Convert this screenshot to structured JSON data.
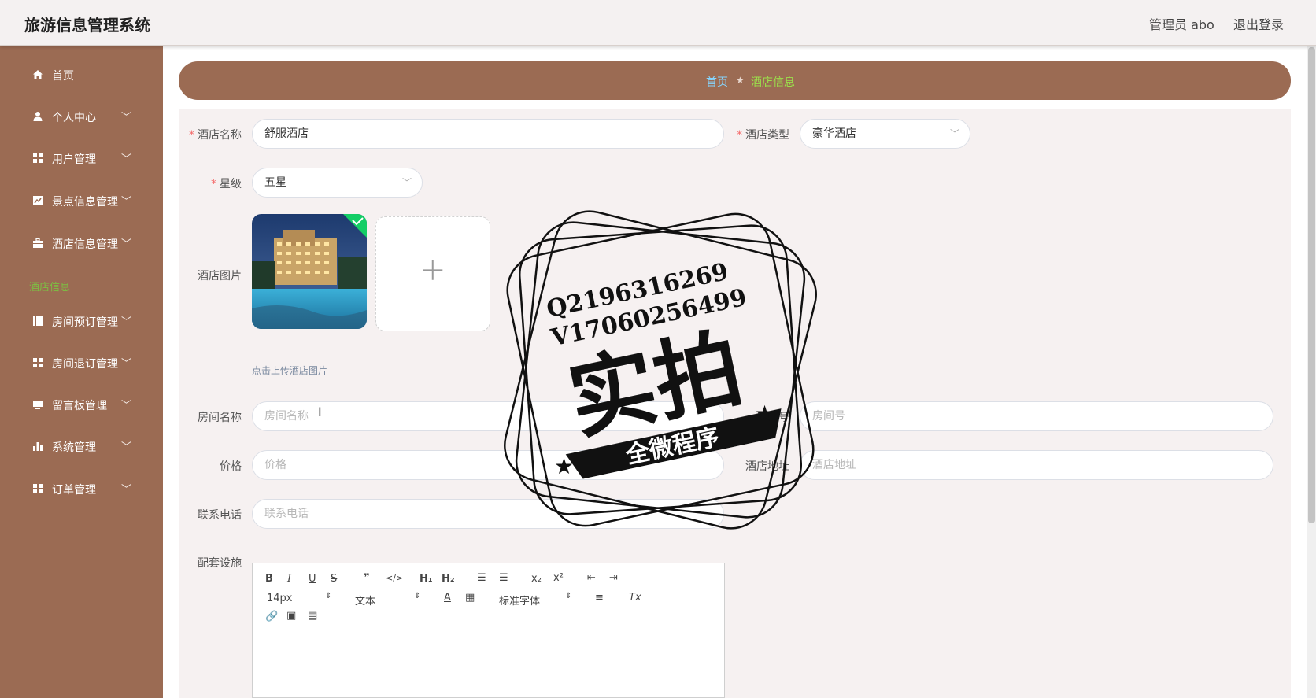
{
  "header": {
    "app_title": "旅游信息管理系统",
    "admin_label": "管理员 abo",
    "logout_label": "退出登录"
  },
  "sidebar": {
    "items": [
      {
        "label": "首页",
        "icon": "home-icon",
        "has_arrow": false
      },
      {
        "label": "个人中心",
        "icon": "user-icon",
        "has_arrow": true
      },
      {
        "label": "用户管理",
        "icon": "grid-icon",
        "has_arrow": true
      },
      {
        "label": "景点信息管理",
        "icon": "chart-icon",
        "has_arrow": true
      },
      {
        "label": "酒店信息管理",
        "icon": "briefcase-icon",
        "has_arrow": true
      },
      {
        "label": "房间预订管理",
        "icon": "book-icon",
        "has_arrow": true
      },
      {
        "label": "房间退订管理",
        "icon": "grid-icon",
        "has_arrow": true
      },
      {
        "label": "留言板管理",
        "icon": "monitor-icon",
        "has_arrow": true
      },
      {
        "label": "系统管理",
        "icon": "bar-chart-icon",
        "has_arrow": true
      },
      {
        "label": "订单管理",
        "icon": "grid-icon",
        "has_arrow": true
      }
    ],
    "active_sub": "酒店信息"
  },
  "breadcrumb": {
    "home": "首页",
    "separator": "★",
    "current": "酒店信息"
  },
  "form": {
    "hotel_name": {
      "label": "酒店名称",
      "value": "舒服酒店",
      "required": true
    },
    "hotel_type": {
      "label": "酒店类型",
      "value": "豪华酒店",
      "required": true
    },
    "star_level": {
      "label": "星级",
      "value": "五星",
      "required": true
    },
    "hotel_image": {
      "label": "酒店图片",
      "hint": "点击上传酒店图片"
    },
    "room_name": {
      "label": "房间名称",
      "placeholder": "房间名称"
    },
    "room_no": {
      "label": "房间号",
      "placeholder": "房间号"
    },
    "price": {
      "label": "价格",
      "placeholder": "价格"
    },
    "hotel_address": {
      "label": "酒店地址",
      "placeholder": "酒店地址"
    },
    "phone": {
      "label": "联系电话",
      "placeholder": "联系电话"
    },
    "facilities": {
      "label": "配套设施"
    }
  },
  "editor": {
    "font_size": "14px",
    "block_format": "文本",
    "font_family": "标准字体"
  },
  "watermark": {
    "line1": "Q2196316269",
    "line2": "V17060256499",
    "main": "实拍",
    "banner": "全微程序"
  },
  "colors": {
    "sidebar_bg": "#9b6b53",
    "active_green": "#7cc043",
    "breadcrumb_home": "#86d6ff",
    "required_star": "#f56c6c"
  }
}
